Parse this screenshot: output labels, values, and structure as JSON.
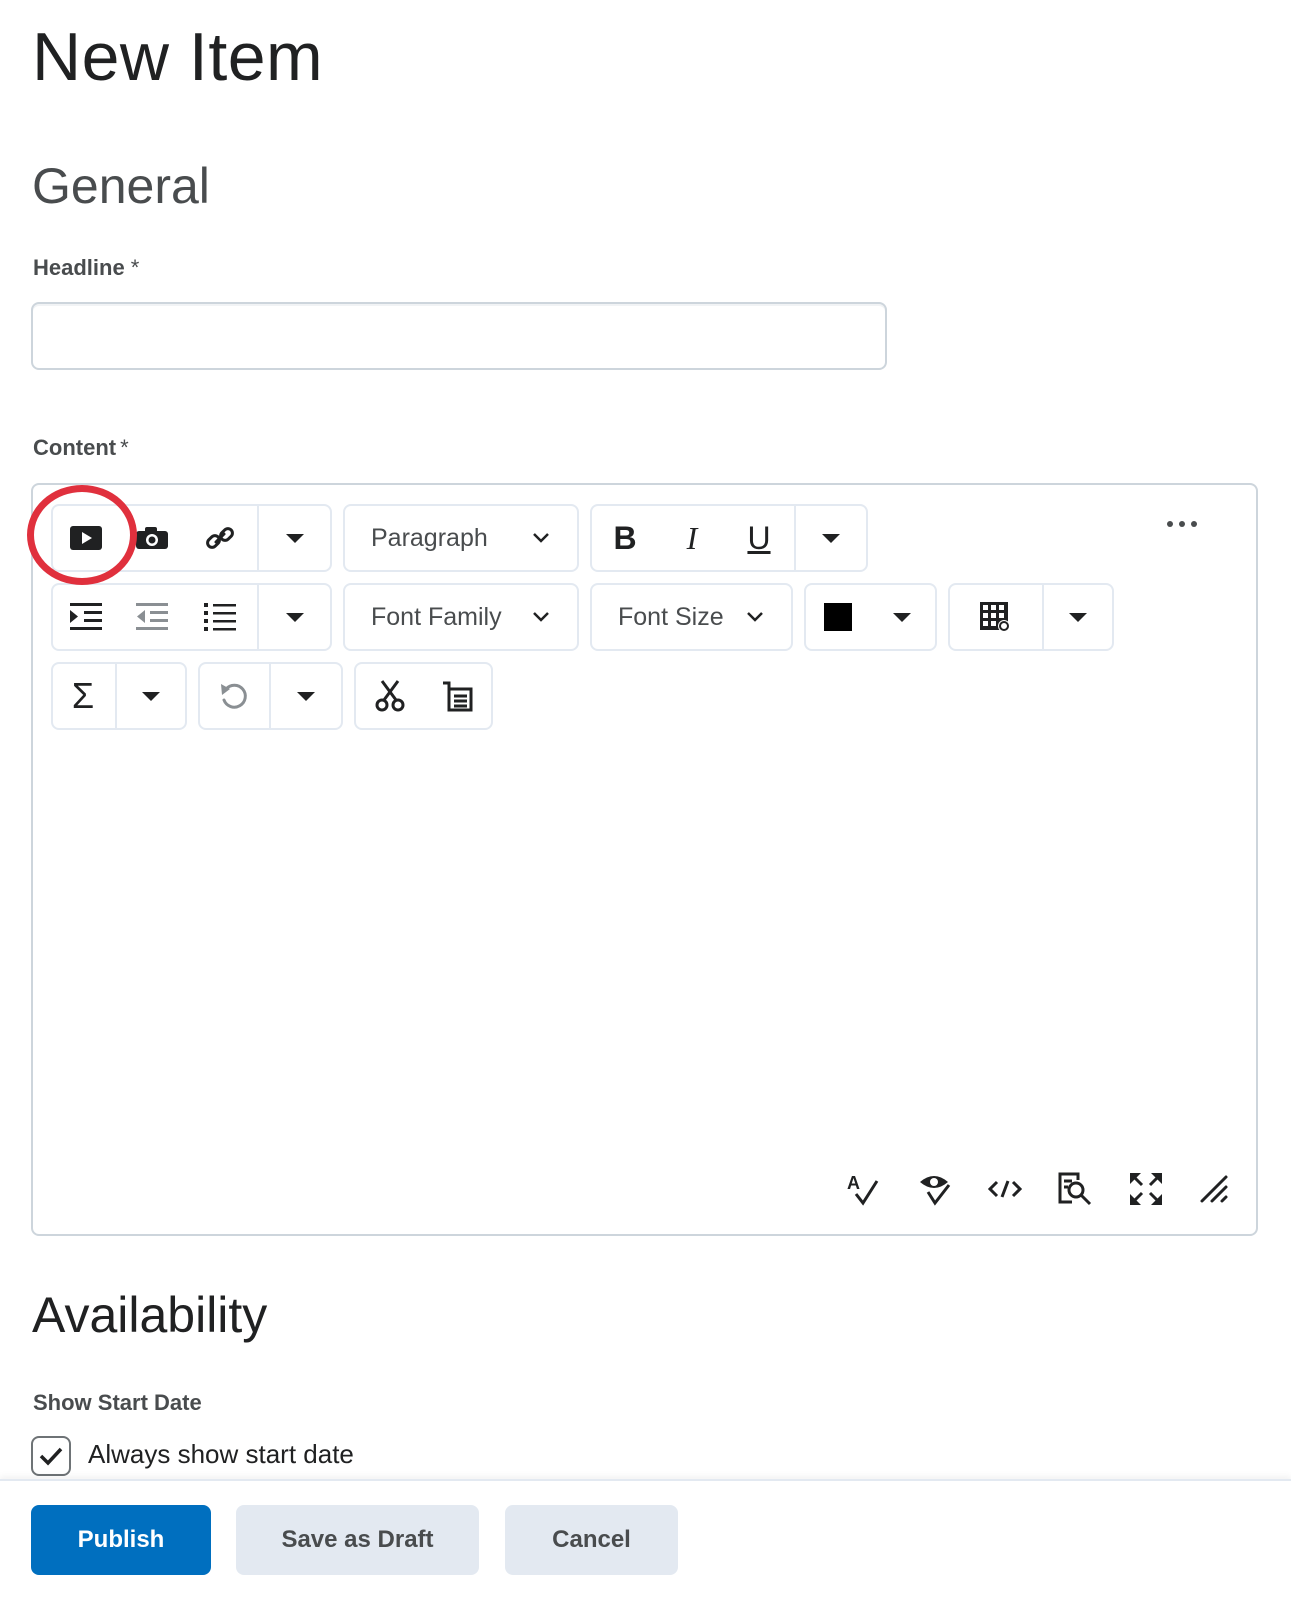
{
  "page": {
    "title": "New Item"
  },
  "general": {
    "title": "General",
    "headline_label": "Headline",
    "headline_required": "*",
    "headline_value": "",
    "content_label": "Content",
    "content_required": "*"
  },
  "editor": {
    "toolbar": {
      "insert_group": [
        "insert-stuff-icon",
        "insert-image-icon",
        "insert-link-icon",
        "dropdown-caret-icon"
      ],
      "format_select": "Paragraph",
      "style_group": {
        "bold": "B",
        "italic": "I",
        "underline": "U"
      },
      "list_group": [
        "indent-icon",
        "outdent-icon",
        "bullet-list-icon",
        "dropdown-caret-icon"
      ],
      "font_family_select": "Font Family",
      "font_size_select": "Font Size",
      "text_color": "#000000",
      "table_group": [
        "table-icon",
        "dropdown-caret-icon"
      ],
      "equation_symbol": "Σ",
      "undo_group": [
        "undo-icon",
        "dropdown-caret-icon"
      ],
      "clipboard_group": [
        "cut-icon",
        "paste-icon"
      ],
      "more_actions": "more-actions-icon"
    },
    "status_icons": [
      "spellcheck-icon",
      "accessibility-checker-icon",
      "source-code-icon",
      "preview-icon",
      "fullscreen-icon",
      "resize-handle-icon"
    ],
    "highlight_color": "#e0303d"
  },
  "availability": {
    "title": "Availability",
    "show_start_label": "Show Start Date",
    "always_show_start": {
      "label": "Always show start date",
      "checked": true
    }
  },
  "footer": {
    "publish": "Publish",
    "save_draft": "Save as Draft",
    "cancel": "Cancel"
  },
  "colors": {
    "primary": "#006fbf",
    "secondary": "#e3e9f1",
    "border": "#cdd5dc"
  }
}
